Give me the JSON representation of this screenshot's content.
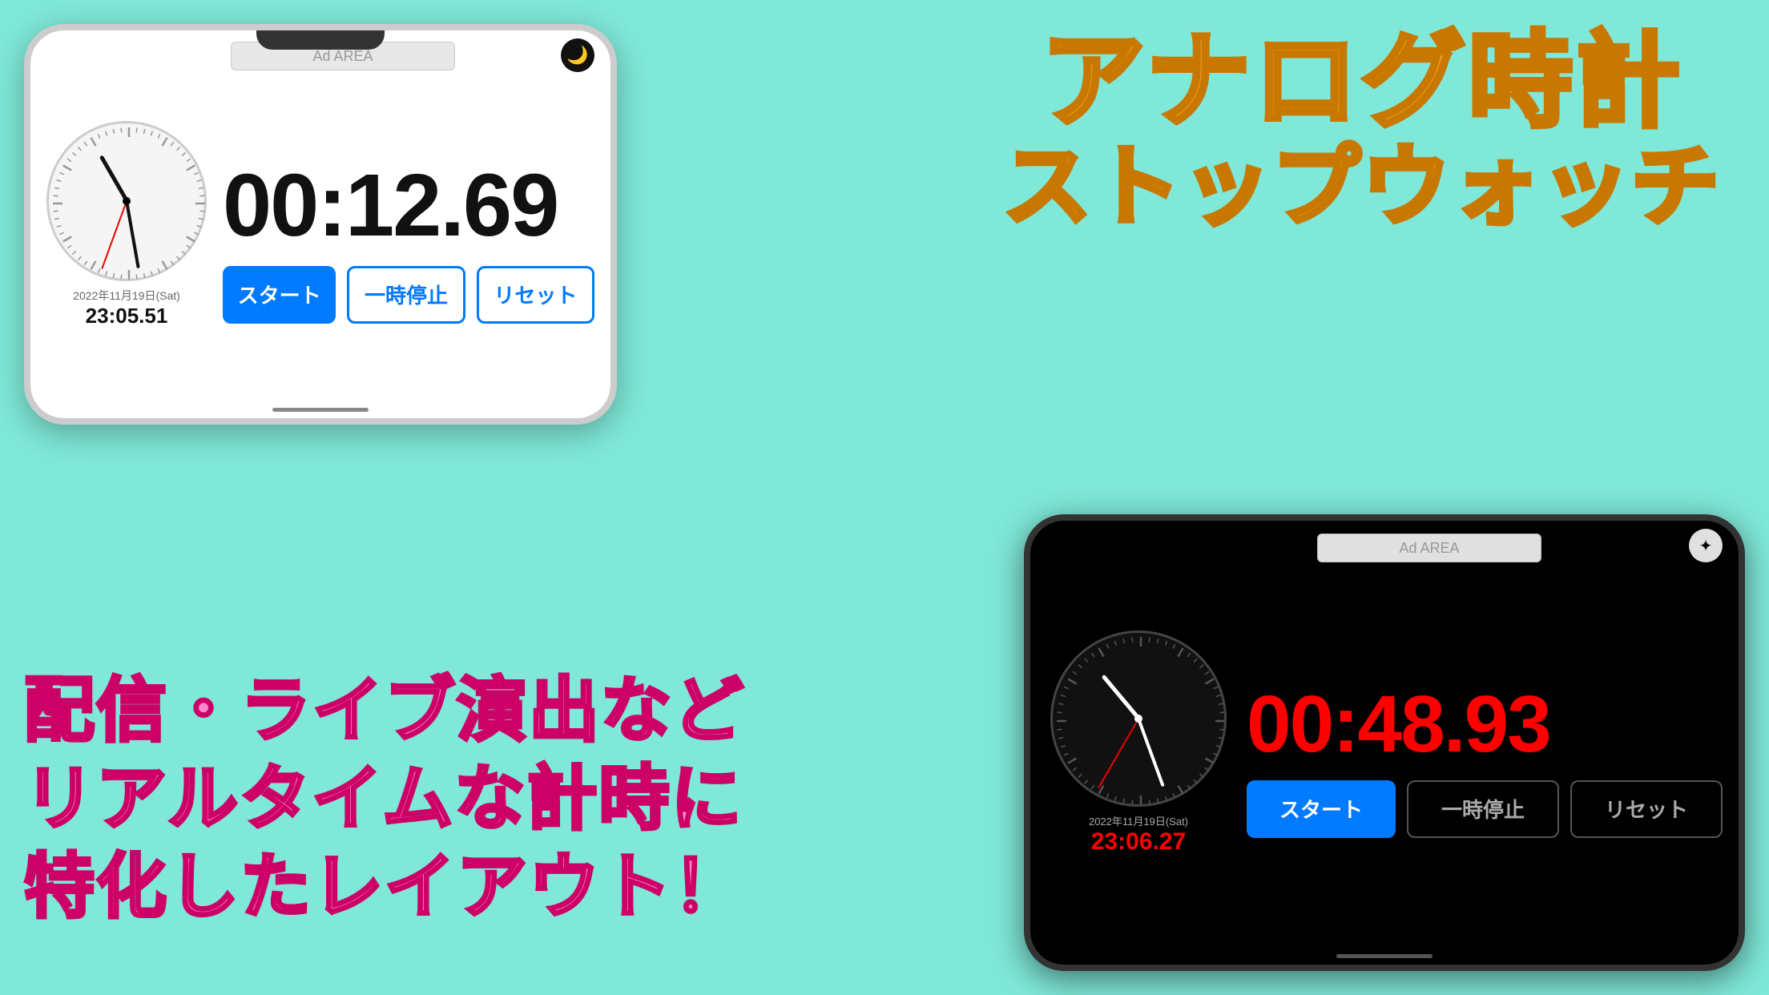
{
  "background_color": "#7fe8d8",
  "app_title": {
    "line1": "アナログ時計",
    "line2": "ストップウォッチ"
  },
  "description": {
    "line1": "配信・ライブ演出など",
    "line2": "リアルタイムな計時に",
    "line3": "特化したレイアウト！"
  },
  "phone_light": {
    "ad_area_label": "Ad  AREA",
    "mode_icon": "🌙",
    "stopwatch_time": "00:12.69",
    "date_text": "2022年11月19日(Sat)",
    "clock_time": "23:05.51",
    "btn_start": "スタート",
    "btn_pause": "一時停止",
    "btn_reset": "リセット"
  },
  "phone_dark": {
    "ad_area_label": "Ad  AREA",
    "mode_icon": "✱",
    "stopwatch_time": "00:48.93",
    "date_text": "2022年11月19日(Sat)",
    "clock_time": "23:06.27",
    "btn_start": "スタート",
    "btn_pause": "一時停止",
    "btn_reset": "リセット"
  }
}
